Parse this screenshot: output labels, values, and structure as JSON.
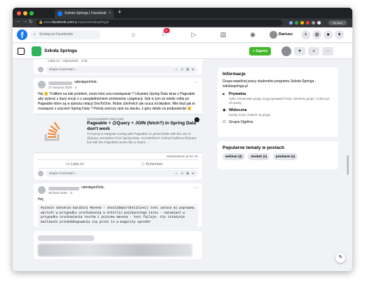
{
  "browser": {
    "tab_title": "Szkoła Springa | Facebook",
    "tab_close": "×",
    "new_tab": "+",
    "url_prefix": "www.",
    "url_domain": "facebook.com",
    "url_path": "/groups/szkolaspringa/",
    "relaunch_label": "Re-lanc"
  },
  "facebook": {
    "logo": "f",
    "search_placeholder": "Szukaj na Facebooku",
    "notification_count": "9+",
    "user_name": "Dariusz"
  },
  "group": {
    "name": "Szkoła Springa",
    "join_label": "+ Zaproś",
    "more_label": "···"
  },
  "feed": {
    "top_likes": "Lubię to! · Odpowiedz · 3 lat",
    "comment_placeholder": "Napisz komentarz...",
    "post1": {
      "shared_label": "udostępnił link.",
      "date": "27 sierpnia 2020 · ⊙",
      "text": "Hej 😊 Trafiłem na taki problem, może ktoś zna rozwiązanie ? Używam Spring Data wraz z Pageable aby wybrać z bazy encje o z uwzględnieniem sortowania i paginacji. Sęk w tym że wtedy robię po Pageable które są w dziecku relacji OneToOne. Robie JoinFetch ale rzuca mi błędem. Wie ktoś jak to rozwiązać z użyciem Spring Data ? Pokrój szerszy opis na stacku, z góry dzięki za podpowiedzi 😊",
      "link_domain": "STACKOVERFLOW.COM",
      "link_title": "Pageable + @Query + JOIN (fetch?) in Spring Data don't work",
      "link_desc": "I'm trying to integrate sorting with Pageable on joined fields with the use of @Query annotation from Spring Data. 1st interface's method (without @Query but with the Pageable) works like a charm. ...",
      "views": "Wyświetlenie przez 32",
      "like_label": "Lubię to!",
      "comment_label": "Komentarz"
    },
    "post2": {
      "shared_label": "udostępnił link.",
      "date": "30 lipca 2020 · ⊙",
      "greeting": "Hej,",
      "text": "Pytanie odnośnie bardziej Mavena - shouldImportEntities() test zwraca mi poprawną wartość w przypadku uruchomienia w IntelliJ pojedynczego testu - natomiast w przypadku uruchomienia testów z poziomu mavena - test failuje. Czy istanieje możliwość przedebbugowania się przez to w magiczny sposób?"
    }
  },
  "sidebar": {
    "info_title": "Informacje",
    "description": "Grupa wspólnej pracy studentów programu Szkoła Springa - szkolaspringa.pl",
    "private_title": "Prywatna",
    "private_desc": "Tylko członkowie grupy mogą sprawdzić listę członków grupy i zobaczyć ich posty.",
    "visible_title": "Widoczna",
    "visible_desc": "Każdy może znaleźć tę grupę.",
    "group_type": "Grupa Ogólna",
    "topics_title": "Popularne tematy w postach",
    "topics": [
      "webinar (3)",
      "moduł1 (1)",
      "powitanie (1)"
    ]
  },
  "colors": {
    "facebook_blue": "#1877f2",
    "join_green": "#42b72a",
    "group_green": "#2fb45a"
  }
}
